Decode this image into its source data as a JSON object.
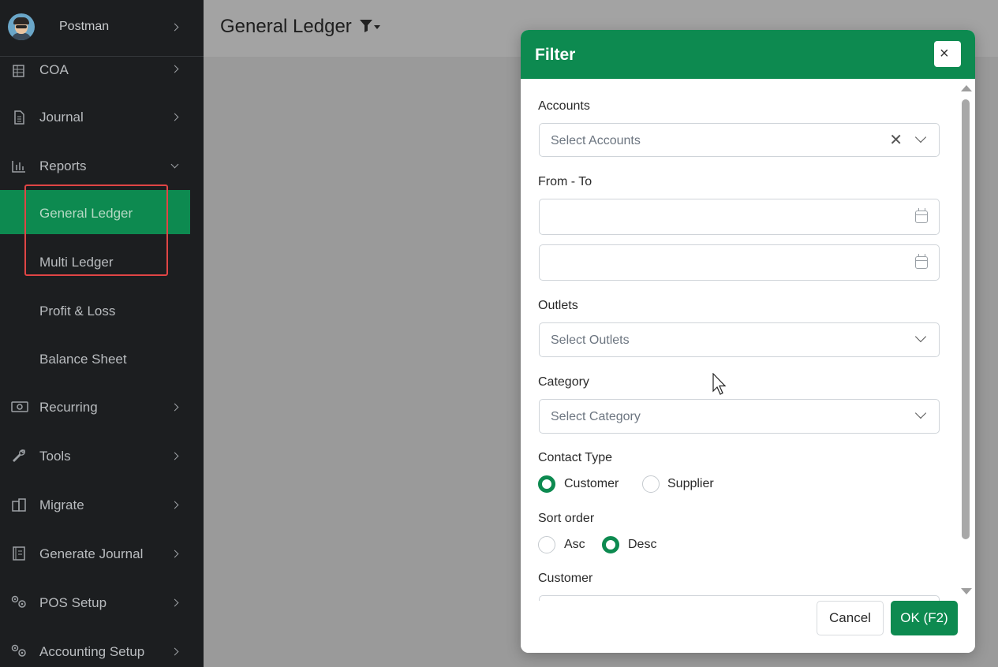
{
  "sidebar": {
    "user": {
      "name": "Postman"
    },
    "items": [
      {
        "label": "COA",
        "icon": "table-grid-icon"
      },
      {
        "label": "Journal",
        "icon": "document-icon"
      },
      {
        "label": "Reports",
        "icon": "bar-chart-icon"
      },
      {
        "label": "Recurring",
        "icon": "cash-icon"
      },
      {
        "label": "Tools",
        "icon": "wrench-icon"
      },
      {
        "label": "Migrate",
        "icon": "migrate-icon"
      },
      {
        "label": "Generate Journal",
        "icon": "ledger-book-icon"
      },
      {
        "label": "POS Setup",
        "icon": "gears-icon"
      },
      {
        "label": "Accounting Setup",
        "icon": "gears-icon"
      }
    ],
    "report_subitems": [
      {
        "label": "General Ledger",
        "active": true
      },
      {
        "label": "Multi Ledger",
        "active": false
      },
      {
        "label": "Profit & Loss",
        "active": false
      },
      {
        "label": "Balance Sheet",
        "active": false
      }
    ]
  },
  "header": {
    "title": "General Ledger",
    "filter_icon": "filter-icon"
  },
  "modal": {
    "title": "Filter",
    "close_label": "×",
    "accounts": {
      "label": "Accounts",
      "placeholder": "Select Accounts"
    },
    "from_to": {
      "label": "From - To",
      "from_value": "",
      "to_value": ""
    },
    "outlets": {
      "label": "Outlets",
      "placeholder": "Select Outlets"
    },
    "category": {
      "label": "Category",
      "placeholder": "Select Category"
    },
    "contact_type": {
      "label": "Contact Type",
      "options": [
        "Customer",
        "Supplier"
      ],
      "selected": "Customer"
    },
    "sort_order": {
      "label": "Sort order",
      "options": [
        "Asc",
        "Desc"
      ],
      "selected": "Desc"
    },
    "customer": {
      "label": "Customer"
    },
    "cancel_label": "Cancel",
    "ok_label": "OK (F2)"
  },
  "colors": {
    "accent": "#0d8a50",
    "sidebar_bg": "#1c1e20",
    "highlight": "#e04545"
  }
}
